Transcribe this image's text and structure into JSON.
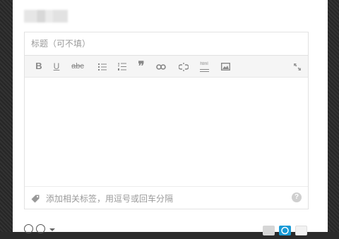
{
  "editor": {
    "title_placeholder": "标题（可不填）",
    "tag_placeholder": "添加相关标签，用逗号或回车分隔",
    "help_label": "?"
  },
  "toolbar": {
    "bold_label": "B",
    "underline_label": "U",
    "strikethrough_label": "abc",
    "quote_label": "❞",
    "html_label": "html"
  },
  "colors": {
    "toolbar_background": "#f5f5f5",
    "border": "#e2e2e2",
    "placeholder_text": "#9a9a9a",
    "icon_gray": "#888888",
    "accent_blue": "#1a9ad6"
  },
  "icons": [
    "bullet-list-icon",
    "numbered-list-icon",
    "link-icon",
    "unlink-icon",
    "image-icon",
    "fullscreen-icon",
    "tag-icon",
    "help-icon"
  ]
}
